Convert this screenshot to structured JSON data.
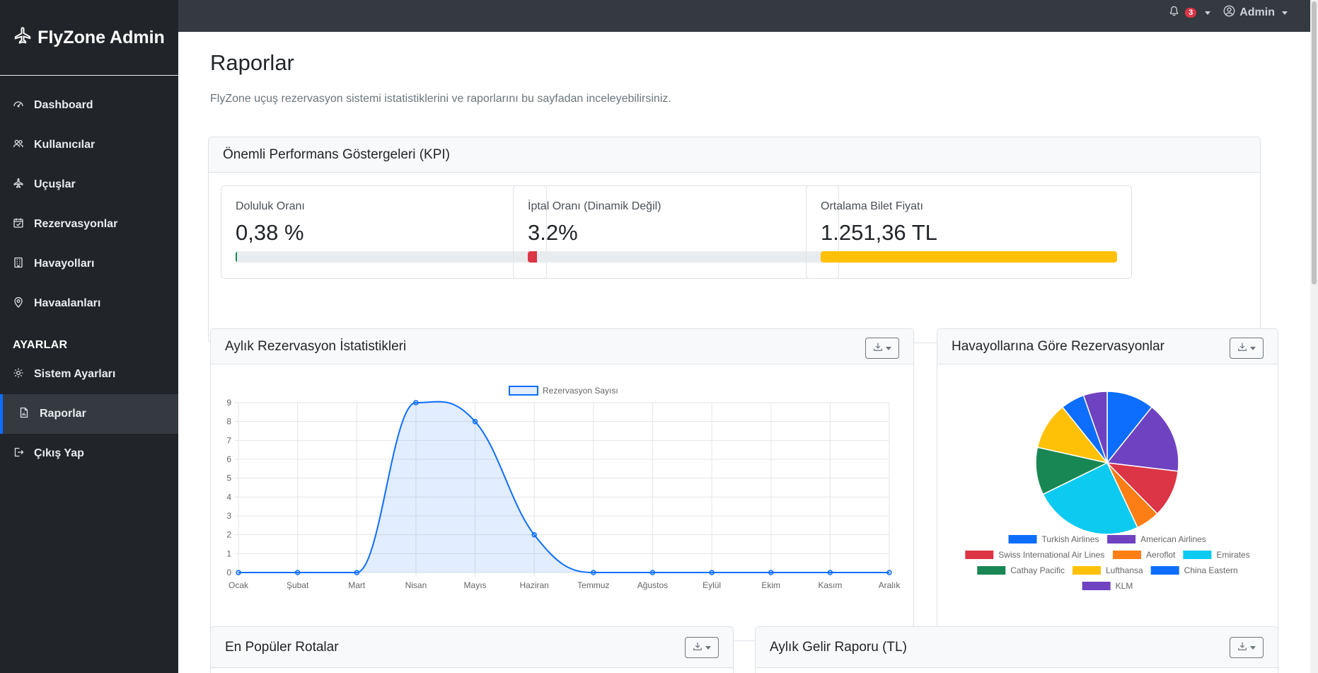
{
  "brand": {
    "title": "FlyZone Admin"
  },
  "sidebar": {
    "items": [
      {
        "label": "Dashboard",
        "icon": "speedometer-icon"
      },
      {
        "label": "Kullanıcılar",
        "icon": "people-icon"
      },
      {
        "label": "Uçuşlar",
        "icon": "airplane-icon"
      },
      {
        "label": "Rezervasyonlar",
        "icon": "calendar-check-icon"
      },
      {
        "label": "Havayolları",
        "icon": "building-icon"
      },
      {
        "label": "Havaalanları",
        "icon": "geo-pin-icon"
      }
    ],
    "settings_heading": "AYARLAR",
    "settings_items": [
      {
        "label": "Sistem Ayarları",
        "icon": "gear-icon"
      },
      {
        "label": "Raporlar",
        "icon": "file-chart-icon",
        "active": true
      },
      {
        "label": "Çıkış Yap",
        "icon": "logout-icon"
      }
    ]
  },
  "topbar": {
    "notification_count": "3",
    "user_label": "Admin"
  },
  "page": {
    "title": "Raporlar",
    "subtitle": "FlyZone uçuş rezervasyon sistemi istatistiklerini ve raporlarını bu sayfadan inceleyebilirsiniz."
  },
  "kpi": {
    "header": "Önemli Performans Göstergeleri (KPI)",
    "cards": [
      {
        "label": "Doluluk Oranı",
        "value": "0,38 %",
        "progress": 0.38,
        "color": "#198754"
      },
      {
        "label": "İptal Oranı (Dinamik Değil)",
        "value": "3.2%",
        "progress": 3.2,
        "color": "#dc3545"
      },
      {
        "label": "Ortalama Bilet Fiyatı",
        "value": "1.251,36 TL",
        "progress": 100,
        "color": "#ffc107"
      }
    ]
  },
  "monthly_card": {
    "title": "Aylık Rezervasyon İstatistikleri"
  },
  "airline_card": {
    "title": "Havayollarına Göre Rezervasyonlar"
  },
  "routes_card": {
    "title": "En Popüler Rotalar"
  },
  "revenue_card": {
    "title": "Aylık Gelir Raporu (TL)"
  },
  "chart_data": [
    {
      "type": "line",
      "series": [
        {
          "name": "Rezervasyon Sayısı",
          "values": [
            0,
            0,
            0,
            9,
            8,
            2,
            0,
            0,
            0,
            0,
            0,
            0
          ],
          "color": "#0d6efd"
        }
      ],
      "categories": [
        "Ocak",
        "Şubat",
        "Mart",
        "Nisan",
        "Mayıs",
        "Haziran",
        "Temmuz",
        "Ağustos",
        "Eylül",
        "Ekim",
        "Kasım",
        "Aralık"
      ],
      "yticks": [
        "0",
        "1",
        "2",
        "3",
        "4",
        "5",
        "6",
        "7",
        "8",
        "9"
      ],
      "ylim": [
        0,
        9
      ],
      "legend": "top",
      "grid": true
    },
    {
      "type": "pie",
      "labels": [
        "Turkish Airlines",
        "American Airlines",
        "Swiss International Air Lines",
        "Aeroflot",
        "Emirates",
        "Cathay Pacific",
        "Lufthansa",
        "China Eastern",
        "KLM"
      ],
      "values": [
        10,
        15,
        10,
        5,
        23,
        10,
        10,
        5,
        5
      ],
      "colors": [
        "#0d6efd",
        "#6f42c1",
        "#dc3545",
        "#fd7e14",
        "#0dcaf0",
        "#198754",
        "#ffc107",
        "#0d6efd",
        "#6f42c1"
      ],
      "legend": "bottom"
    }
  ]
}
